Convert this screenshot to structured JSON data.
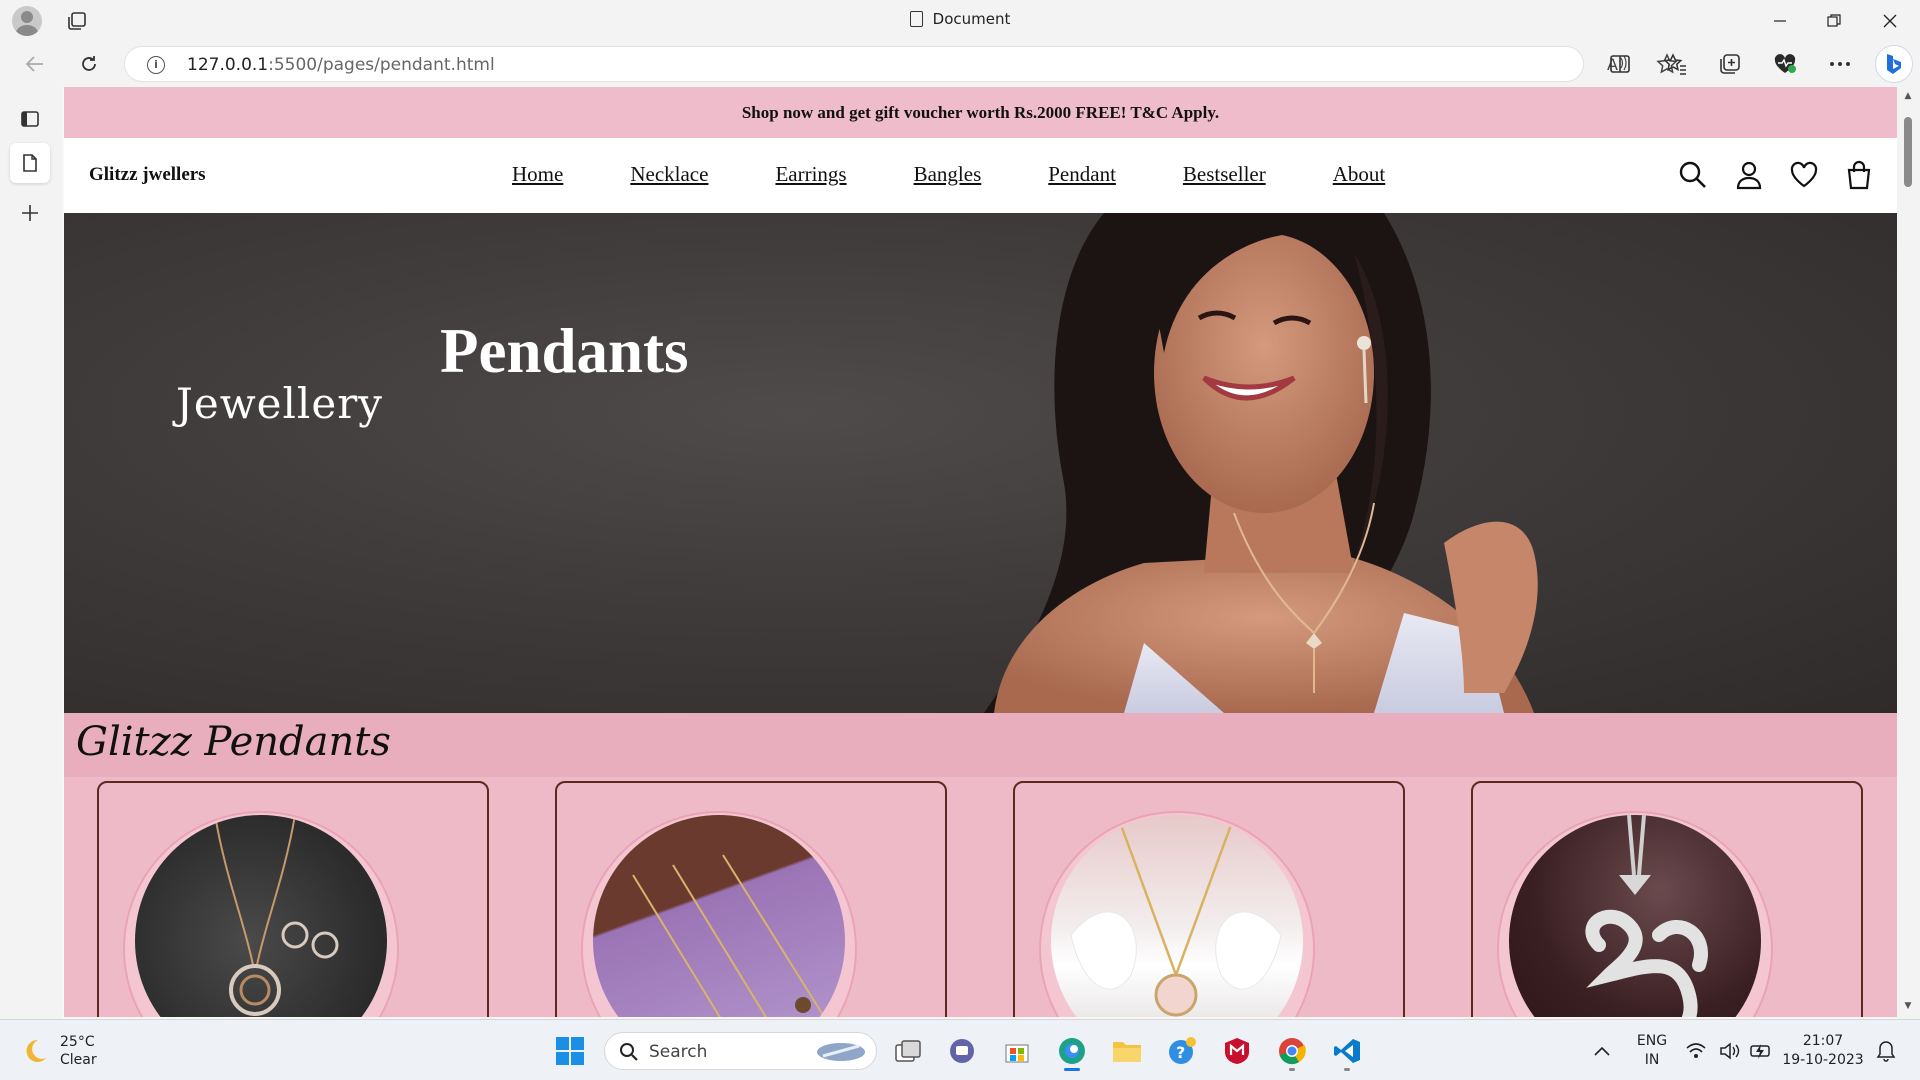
{
  "browser": {
    "tab_title": "Document",
    "url_host": "127.0.0.1",
    "url_path": ":5500/pages/pendant.html"
  },
  "site": {
    "promo": "Shop now and get gift voucher worth Rs.2000 FREE! T&C Apply.",
    "brand": "Glitzz jwellers",
    "nav": [
      "Home",
      "Necklace",
      "Earrings",
      "Bangles",
      "Pendant",
      "Bestseller",
      "About"
    ],
    "hero_title": "Pendants",
    "hero_subtitle": "Jewellery",
    "section_title": "Glitzz Pendants"
  },
  "taskbar": {
    "temperature": "25°C",
    "condition": "Clear",
    "search_label": "Search",
    "lang_top": "ENG",
    "lang_bottom": "IN",
    "time": "21:07",
    "date": "19-10-2023"
  },
  "colors": {
    "promo_bg": "#efbccb",
    "section_bg": "#e8aebd",
    "card_border": "#5a2a1e"
  }
}
